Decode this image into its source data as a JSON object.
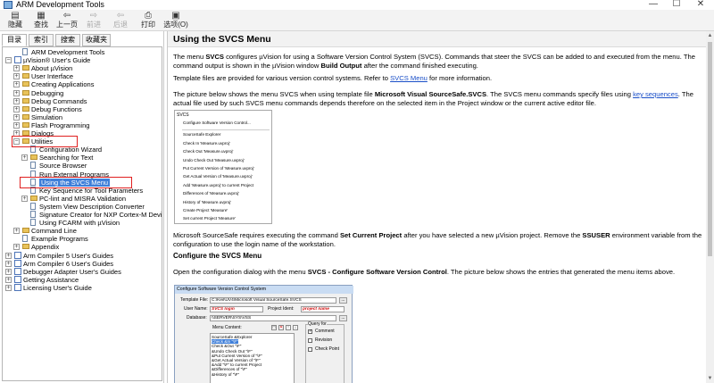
{
  "window": {
    "title": "ARM Development Tools",
    "minimize": "—",
    "maximize": "☐",
    "close": "✕"
  },
  "toolbar": [
    {
      "label": "隐藏",
      "icon": "hide-icon",
      "glyph": "▤",
      "enabled": true
    },
    {
      "label": "查找",
      "icon": "find-icon",
      "glyph": "▦",
      "enabled": true
    },
    {
      "label": "上一页",
      "icon": "back-icon",
      "glyph": "⇦",
      "enabled": true
    },
    {
      "label": "前进",
      "icon": "forward-icon",
      "glyph": "⇨",
      "enabled": false
    },
    {
      "label": "后退",
      "icon": "go-back-icon",
      "glyph": "⇦",
      "enabled": false
    },
    {
      "label": "打印",
      "icon": "print-icon",
      "glyph": "⎙",
      "enabled": true
    },
    {
      "label": "选项(O)",
      "icon": "options-icon",
      "glyph": "▣",
      "enabled": true
    }
  ],
  "tabs": [
    "目录(C)",
    "索引(N)",
    "搜索(S)",
    "收藏夹(I)"
  ],
  "tree": [
    {
      "label": "ARM Development Tools",
      "indent": 1,
      "expander": "",
      "icon": "page"
    },
    {
      "label": "µVision® User's Guide",
      "indent": 0,
      "expander": "−",
      "icon": "book"
    },
    {
      "label": "About µVision",
      "indent": 1,
      "expander": "+",
      "icon": "folder"
    },
    {
      "label": "User Interface",
      "indent": 1,
      "expander": "+",
      "icon": "folder"
    },
    {
      "label": "Creating Applications",
      "indent": 1,
      "expander": "+",
      "icon": "folder"
    },
    {
      "label": "Debugging",
      "indent": 1,
      "expander": "+",
      "icon": "folder"
    },
    {
      "label": "Debug Commands",
      "indent": 1,
      "expander": "+",
      "icon": "folder"
    },
    {
      "label": "Debug Functions",
      "indent": 1,
      "expander": "+",
      "icon": "folder"
    },
    {
      "label": "Simulation",
      "indent": 1,
      "expander": "+",
      "icon": "folder"
    },
    {
      "label": "Flash Programming",
      "indent": 1,
      "expander": "+",
      "icon": "folder"
    },
    {
      "label": "Dialogs",
      "indent": 1,
      "expander": "+",
      "icon": "folder"
    },
    {
      "label": "Utilities",
      "indent": 1,
      "expander": "−",
      "icon": "folder"
    },
    {
      "label": "Configuration Wizard",
      "indent": 2,
      "expander": "",
      "icon": "page"
    },
    {
      "label": "Searching for Text",
      "indent": 2,
      "expander": "+",
      "icon": "folder"
    },
    {
      "label": "Source Browser",
      "indent": 2,
      "expander": "",
      "icon": "page"
    },
    {
      "label": "Run External Programs",
      "indent": 2,
      "expander": "",
      "icon": "page"
    },
    {
      "label": "Using the SVCS Menu",
      "indent": 2,
      "expander": "",
      "icon": "page",
      "selected": true
    },
    {
      "label": "Key Sequence for Tool Parameters",
      "indent": 2,
      "expander": "",
      "icon": "page"
    },
    {
      "label": "PC-lint and MISRA Validation",
      "indent": 2,
      "expander": "+",
      "icon": "folder"
    },
    {
      "label": "System View Description Converter",
      "indent": 2,
      "expander": "",
      "icon": "page"
    },
    {
      "label": "Signature Creator for NXP Cortex-M Devices",
      "indent": 2,
      "expander": "",
      "icon": "page"
    },
    {
      "label": "Using FCARM with µVision",
      "indent": 2,
      "expander": "",
      "icon": "page"
    },
    {
      "label": "Command Line",
      "indent": 1,
      "expander": "+",
      "icon": "folder"
    },
    {
      "label": "Example Programs",
      "indent": 1,
      "expander": "",
      "icon": "page"
    },
    {
      "label": "Appendix",
      "indent": 1,
      "expander": "+",
      "icon": "folder"
    },
    {
      "label": "Arm Compiler 5 User's Guides",
      "indent": 0,
      "expander": "+",
      "icon": "book"
    },
    {
      "label": "Arm Compiler 6 User's Guides",
      "indent": 0,
      "expander": "+",
      "icon": "book"
    },
    {
      "label": "Debugger Adapter User's Guides",
      "indent": 0,
      "expander": "+",
      "icon": "book"
    },
    {
      "label": "Getting Assistance",
      "indent": 0,
      "expander": "+",
      "icon": "book"
    },
    {
      "label": "Licensing User's Guide",
      "indent": 0,
      "expander": "+",
      "icon": "book"
    }
  ],
  "content": {
    "title": "Using the SVCS Menu",
    "p1": {
      "a": "The menu ",
      "b": "SVCS",
      "c": " configures µVision for using a Software Version Control System (SVCS). Commands that steer the SVCS can be added to and executed from the menu. The command output is shown in the µVision window ",
      "d": "Build Output",
      "e": " after the command finished executing."
    },
    "p2": {
      "a": "Template files are provided for various version control systems. Refer to ",
      "link": "SVCS Menu",
      "b": " for more information."
    },
    "p3": {
      "a": "The picture below shows the menu SVCS when using template file ",
      "b": "Microsoft Visual SourceSafe.SVCS",
      "c": ". The SVCS menu commands specify files using ",
      "link": "key sequences",
      "d": ". The actual file used by such SVCS menu commands depends therefore on the selected item in the Project window or the current active editor file."
    },
    "menu_figure": {
      "header": "SVCS",
      "groups": [
        [
          "Configure Software Version Control..."
        ],
        [
          "SourceSafe Explorer",
          "Check In 'Measure.uvproj'",
          "Check Out 'Measure.uvproj'",
          "Undo Check Out 'Measure.uvproj'",
          "Put Current Version of 'Measure.uvproj'",
          "Get Actual Version of 'Measure.uvproj'",
          "Add 'Measure.uvproj' to current Project",
          "Differences of 'Measure.uvproj'",
          "History of 'Measure.uvproj'",
          "Create Project 'Measure'",
          "Set current Project 'Measure'"
        ]
      ]
    },
    "p4": {
      "a": "Microsoft SourceSafe requires executing the command ",
      "b": "Set Current Project",
      "c": " after you have selected a new µVision project. Remove the ",
      "d": "SSUSER",
      "e": " environment variable from the configuration to use the login name of the workstation."
    },
    "h2": "Configure the SVCS Menu",
    "p5": {
      "a": "Open the configuration dialog with the menu ",
      "b": "SVCS - Configure Software Version Control",
      "c": ". The picture below shows the entries that generated the menu items above."
    },
    "dialog": {
      "title": "Configure Software Version Control System",
      "template_label": "Template File:",
      "template_value": "C:\\Keil\\UV4\\Microsoft Visual SourceSafe.SVCS",
      "username_label": "User Name:",
      "username_value": "SVCS login",
      "project_ident_label": "Project Ident:",
      "project_ident_value": "project name",
      "database_label": "Database:",
      "database_value": "\\\\SERVER\\SYS\\VSS",
      "menu_content_label": "Menu Content:",
      "browse": "...",
      "menu_items": [
        "SourceSafe &Explorer",
        "Check &In \"\\F\"",
        "Check &Out \"\\F\"",
        "&Undo Check Out \"\\F\"",
        "&Put Current Version of \"\\F\"",
        "&Get Actual Version of \"\\F\"",
        "&Add \"\\F\" to current Project",
        "&Differences of \"\\F\"",
        "&History of \"\\F\""
      ],
      "selected_index": 1,
      "query_label": "Query for",
      "query_options": [
        {
          "label": "Comment",
          "checked": true
        },
        {
          "label": "Revision",
          "checked": false
        },
        {
          "label": "Check Point",
          "checked": false
        }
      ]
    }
  }
}
